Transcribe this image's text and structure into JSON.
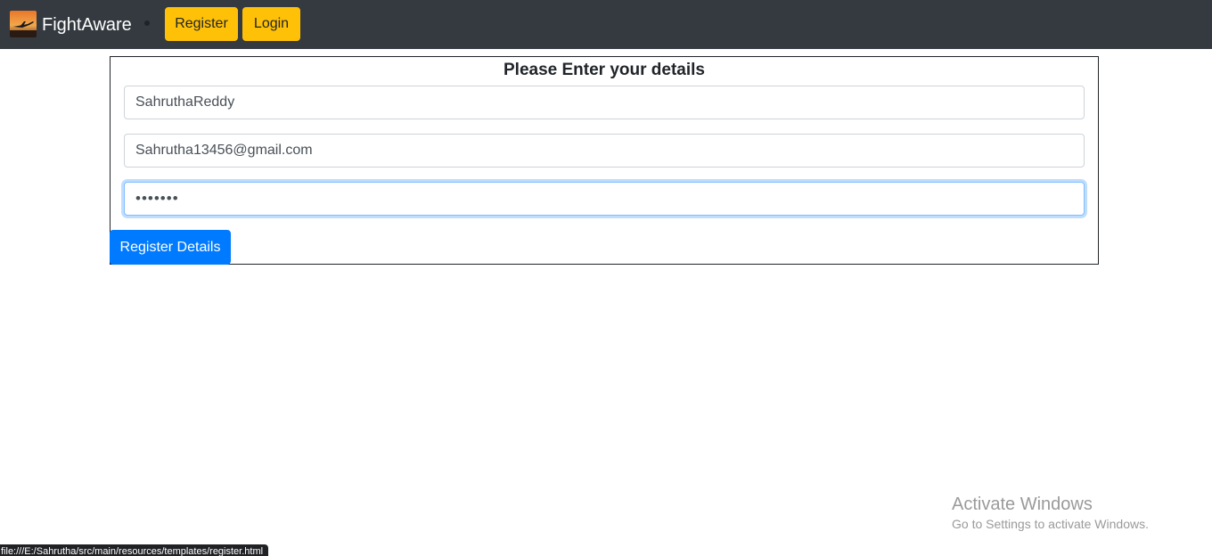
{
  "navbar": {
    "brand_icon": "airplane-sunset-logo-icon",
    "brand_name": "FightAware",
    "register_label": "Register",
    "login_label": "Login",
    "background_color": "#343a40",
    "button_color": "#ffc107"
  },
  "form": {
    "title": "Please Enter your details",
    "username_value": "SahruthaReddy",
    "email_value": "Sahrutha13456@gmail.com",
    "password_masked": "•••••••",
    "submit_label": "Register Details",
    "submit_color": "#007bff"
  },
  "watermark": {
    "title": "Activate Windows",
    "subtitle": "Go to Settings to activate Windows."
  },
  "status_bar": {
    "url": "file:///E:/Sahrutha/src/main/resources/templates/register.html"
  }
}
